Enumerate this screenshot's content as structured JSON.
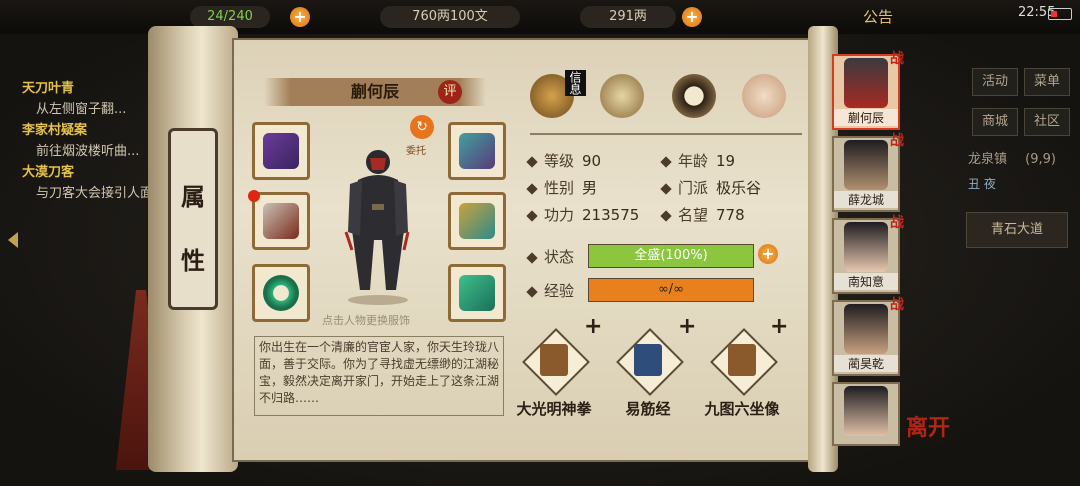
{
  "topbar": {
    "stamina": "24/240",
    "money": "760两100文",
    "silver": "291两",
    "announcement": "公告",
    "time": "22:55"
  },
  "quests": [
    {
      "title": "天刀叶青",
      "desc": "从左侧窗子翻..."
    },
    {
      "title": "李家村疑案",
      "desc": "前往烟波楼听曲..."
    },
    {
      "title": "大漠刀客",
      "desc": "与刀客大会接引人面"
    }
  ],
  "right_menu": {
    "buttons": [
      "活动",
      "菜单",
      "商城",
      "社区"
    ],
    "location": "龙泉镇",
    "coords": "(9,9)",
    "time_slot": "丑 夜",
    "road": "青石大道"
  },
  "scroll": {
    "tab_chars": [
      "属",
      "性"
    ]
  },
  "character": {
    "name": "蒯何辰",
    "eval_badge": "评",
    "delegate": "委托",
    "change_hint": "点击人物更换服饰",
    "bio": "你出生在一个清廉的官宦人家，你天生玲珑八面，善于交际。你为了寻找虚无缥缈的江湖秘宝，毅然决定离开家门，开始走上了这条江湖不归路……"
  },
  "top_icons": [
    {
      "name": "info-icon",
      "label": "信息"
    },
    {
      "name": "map-scroll-icon",
      "label": ""
    },
    {
      "name": "bagua-icon",
      "label": ""
    },
    {
      "name": "meridian-body-icon",
      "label": ""
    }
  ],
  "stats": {
    "level_label": "等级",
    "level": "90",
    "age_label": "年龄",
    "age": "19",
    "gender_label": "性别",
    "gender": "男",
    "sect_label": "门派",
    "sect": "极乐谷",
    "power_label": "功力",
    "power": "213575",
    "fame_label": "名望",
    "fame": "778",
    "status_label": "状态",
    "status_text": "全盛(100%)",
    "status_fraction": 1.0,
    "exp_label": "经验",
    "exp_text": "∞/∞",
    "exp_fraction": 1.0
  },
  "skills": [
    {
      "name": "大光明神拳",
      "color": "#8a5a2c"
    },
    {
      "name": "易筋经",
      "color": "#2f4d7a"
    },
    {
      "name": "九图六坐像",
      "color": "#8a5a2c"
    }
  ],
  "party": [
    {
      "name": "蒯何辰",
      "war": "战",
      "selected": true
    },
    {
      "name": "薛龙城",
      "war": "战",
      "selected": false
    },
    {
      "name": "南知意",
      "war": "战",
      "selected": false
    },
    {
      "name": "蔺昊乾",
      "war": "战",
      "selected": false
    },
    {
      "name": "",
      "war": "",
      "selected": false
    }
  ],
  "leave_label": "离开",
  "colors": {
    "status_bar": "#8cc63f",
    "exp_bar": "#e8801e",
    "accent_red": "#c0241b"
  }
}
